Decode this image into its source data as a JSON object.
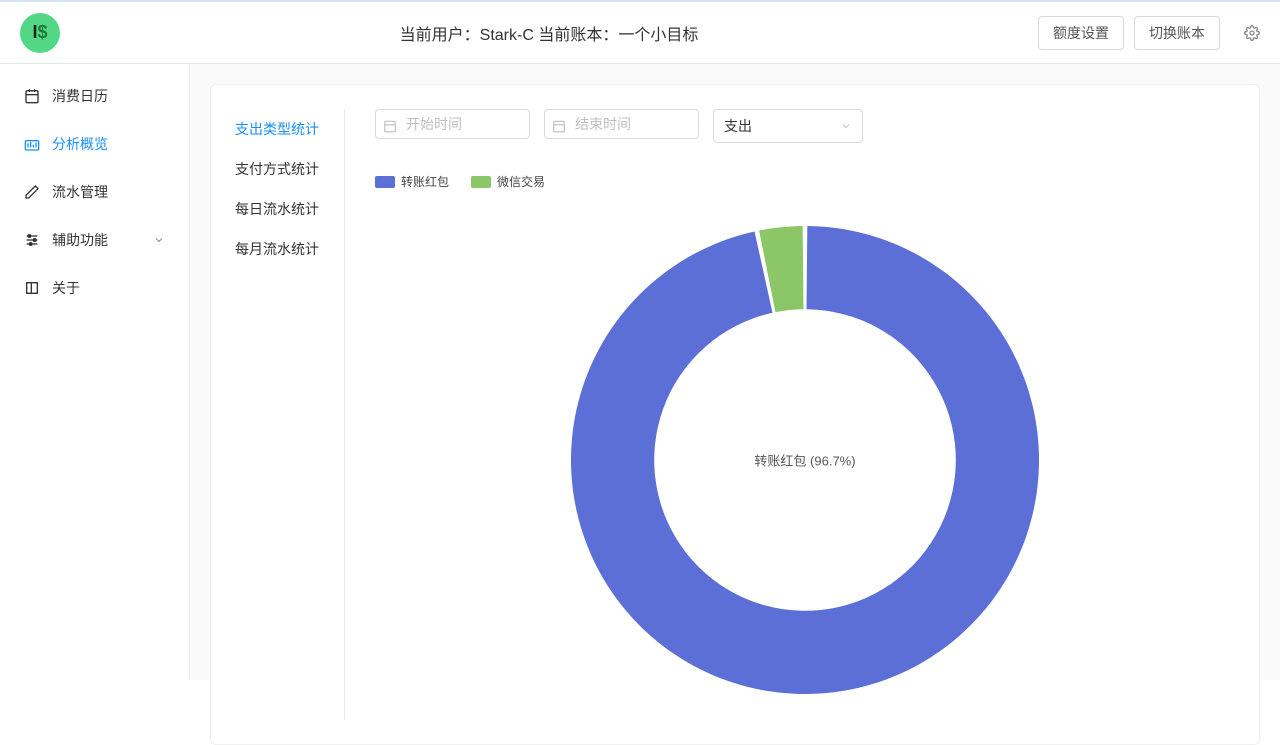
{
  "header": {
    "title": "当前用户：Stark-C  当前账本：一个小目标",
    "quota_btn": "额度设置",
    "switch_btn": "切换账本"
  },
  "sidebar": {
    "items": [
      {
        "label": "消费日历",
        "icon": "calendar"
      },
      {
        "label": "分析概览",
        "icon": "dashboard"
      },
      {
        "label": "流水管理",
        "icon": "edit"
      },
      {
        "label": "辅助功能",
        "icon": "sliders",
        "expandable": true
      },
      {
        "label": "关于",
        "icon": "book"
      }
    ]
  },
  "tabs": [
    "支出类型统计",
    "支付方式统计",
    "每日流水统计",
    "每月流水统计"
  ],
  "filters": {
    "start_placeholder": "开始时间",
    "end_placeholder": "结束时间",
    "select_value": "支出"
  },
  "legend": [
    {
      "label": "转账红包",
      "color": "#5b6fd6"
    },
    {
      "label": "微信交易",
      "color": "#8bc767"
    }
  ],
  "chart_data": {
    "type": "pie",
    "title": "",
    "center_label": "转账红包 (96.7%)",
    "series": [
      {
        "name": "转账红包",
        "value": 96.7,
        "color": "#5b6fd6"
      },
      {
        "name": "微信交易",
        "value": 3.3,
        "color": "#8bc767"
      }
    ]
  }
}
